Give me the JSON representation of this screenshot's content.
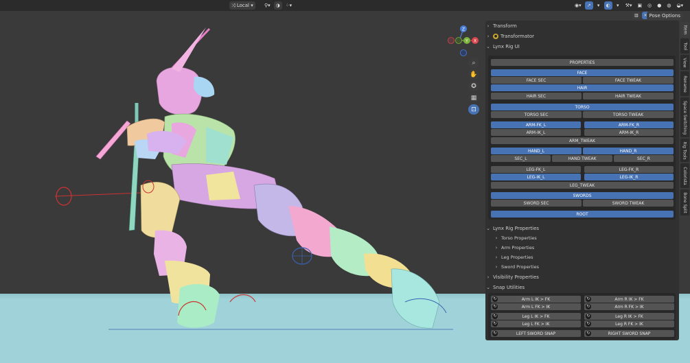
{
  "header": {
    "orientation_label": "Local",
    "orientation_icon": "transform-orientation-icon",
    "pose_options_label": "Pose Options"
  },
  "npanel": {
    "transform_label": "Transform",
    "transformator_label": "Transformator",
    "lynx_rig_ui_label": "Lynx Rig UI",
    "rig_buttons": {
      "properties": "PROPERTIES",
      "face": "FACE",
      "face_sec": "FACE SEC",
      "face_tweak": "FACE TWEAK",
      "hair": "HAIR",
      "hair_sec": "HAIR SEC",
      "hair_tweak": "HAIR TWEAK",
      "torso": "TORSO",
      "torso_sec": "TORSO SEC",
      "torso_tweak": "TORSO TWEAK",
      "arm_fk_l": "ARM-FK_L",
      "arm_fk_r": "ARM-FK_R",
      "arm_ik_l": "ARM-IK_L",
      "arm_ik_r": "ARM-IK_R",
      "arm_tweak": "ARM_TWEAK",
      "hand_l": "HAND_L",
      "hand_r": "HAND_R",
      "sec_l": "SEC_L",
      "hand_tweak": "HAND TWEAK",
      "sec_r": "SEC_R",
      "leg_fk_l": "LEG-FK_L",
      "leg_fk_r": "LEG-FK_R",
      "leg_ik_l": "LEG-IK_L",
      "leg_ik_r": "LEG-IK_R",
      "leg_tweak": "LEG_TWEAK",
      "swords": "SWORDS",
      "sword_sec": "SWORD SEC",
      "sword_tweak": "SWORD TWEAK",
      "root": "ROOT"
    },
    "lynx_rig_properties_label": "Lynx Rig Properties",
    "property_items": [
      "Torso Properties",
      "Arm Properties",
      "Leg Properties",
      "Sword Properties"
    ],
    "visibility_properties_label": "Visibility Properties",
    "snap_utilities_label": "Snap Utilities",
    "snap_buttons": {
      "arm_l_ik_fk": "Arm L IK > FK",
      "arm_r_ik_fk": "Arm R IK > FK",
      "arm_l_fk_ik": "Arm L FK > IK",
      "arm_r_fk_ik": "Arm R FK > IK",
      "leg_l_ik_fk": "Leg L IK > FK",
      "leg_r_ik_fk": "Leg R IK > FK",
      "leg_l_fk_ik": "Leg L FK > IK",
      "leg_r_fk_ik": "Leg R FK > IK",
      "left_sword_snap": "LEFT SWORD SNAP",
      "right_sword_snap": "RIGHT SWORD SNAP"
    }
  },
  "tabs": [
    "Item",
    "Tool",
    "View",
    "Rename",
    "Space Switching",
    "Rig Tools",
    "Colorista",
    "Bone Split"
  ],
  "gizmo": {
    "z": "Z",
    "y": "Y",
    "x": "X"
  },
  "colors": {
    "accent": "#4772b3",
    "button": "#545454",
    "panel": "#303030",
    "floor": "#9fd3d9",
    "viewport": "#3a3a3a"
  }
}
